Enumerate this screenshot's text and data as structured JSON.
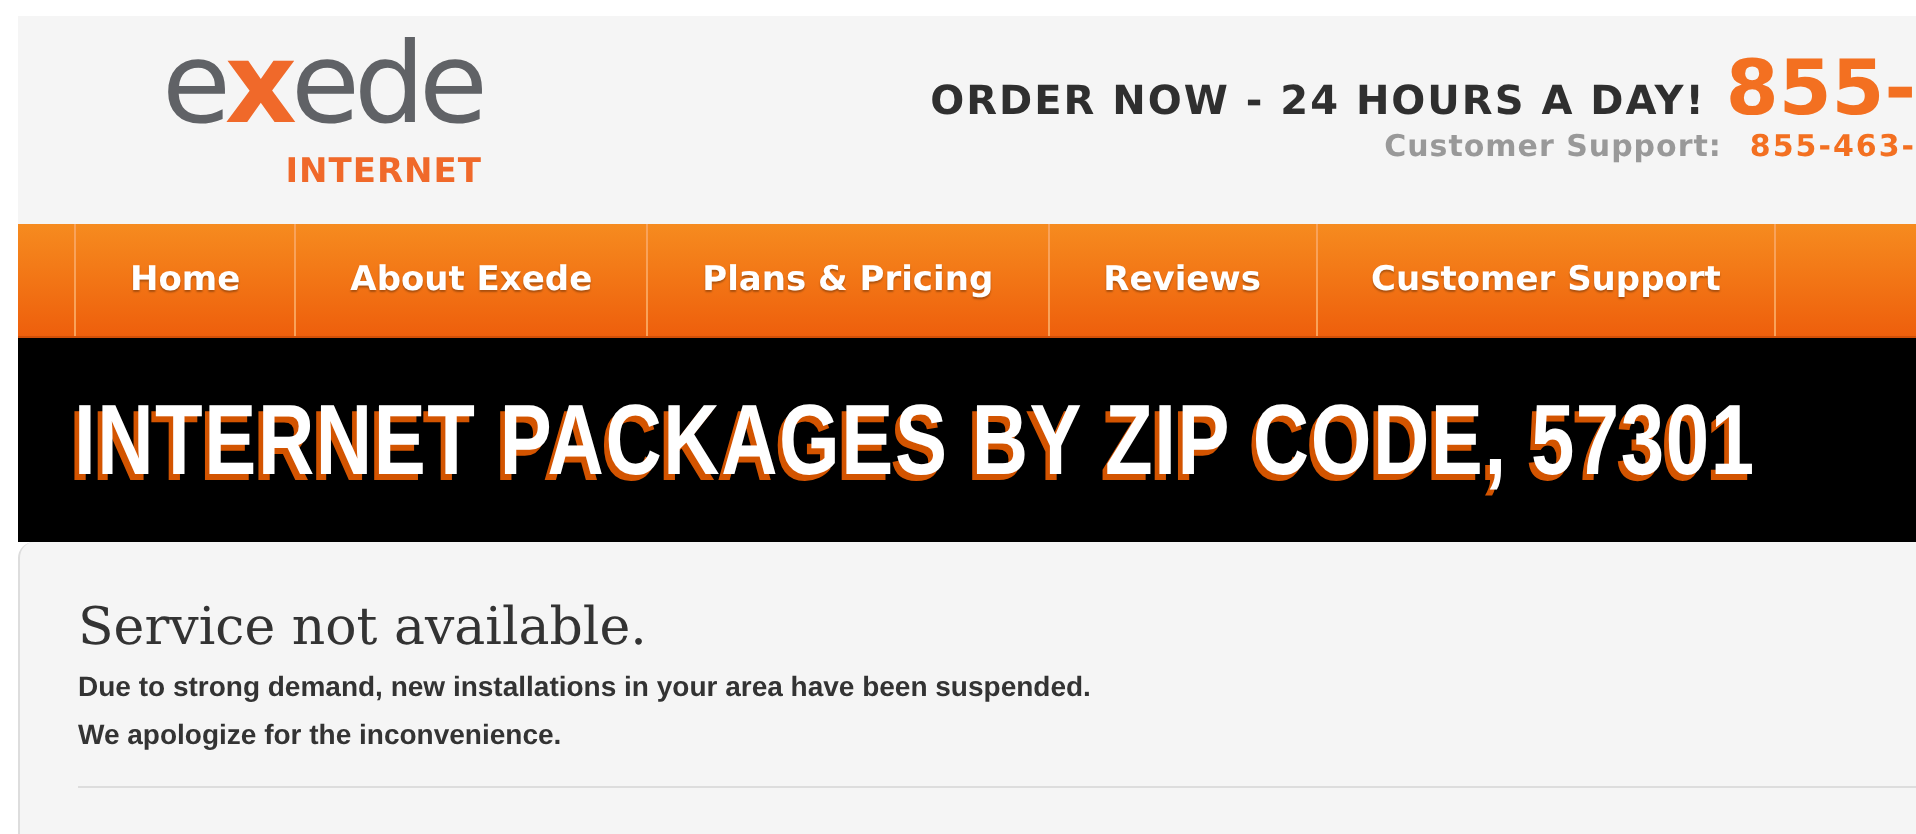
{
  "logo": {
    "wordmark": "exede",
    "subtitle": "INTERNET"
  },
  "header": {
    "order_text": "ORDER NOW - 24 HOURS A DAY!",
    "order_phone": "855-",
    "support_label": "Customer Support:",
    "support_phone": "855-463-"
  },
  "nav": {
    "items": [
      {
        "label": "Home"
      },
      {
        "label": "About Exede"
      },
      {
        "label": "Plans & Pricing"
      },
      {
        "label": "Reviews"
      },
      {
        "label": "Customer Support"
      }
    ]
  },
  "banner": {
    "title": "INTERNET PACKAGES BY ZIP CODE, 57301"
  },
  "notice": {
    "title": "Service not available.",
    "lines": [
      "Due to strong demand, new installations in your area have been suspended.",
      "We apologize for the inconvenience."
    ]
  }
}
